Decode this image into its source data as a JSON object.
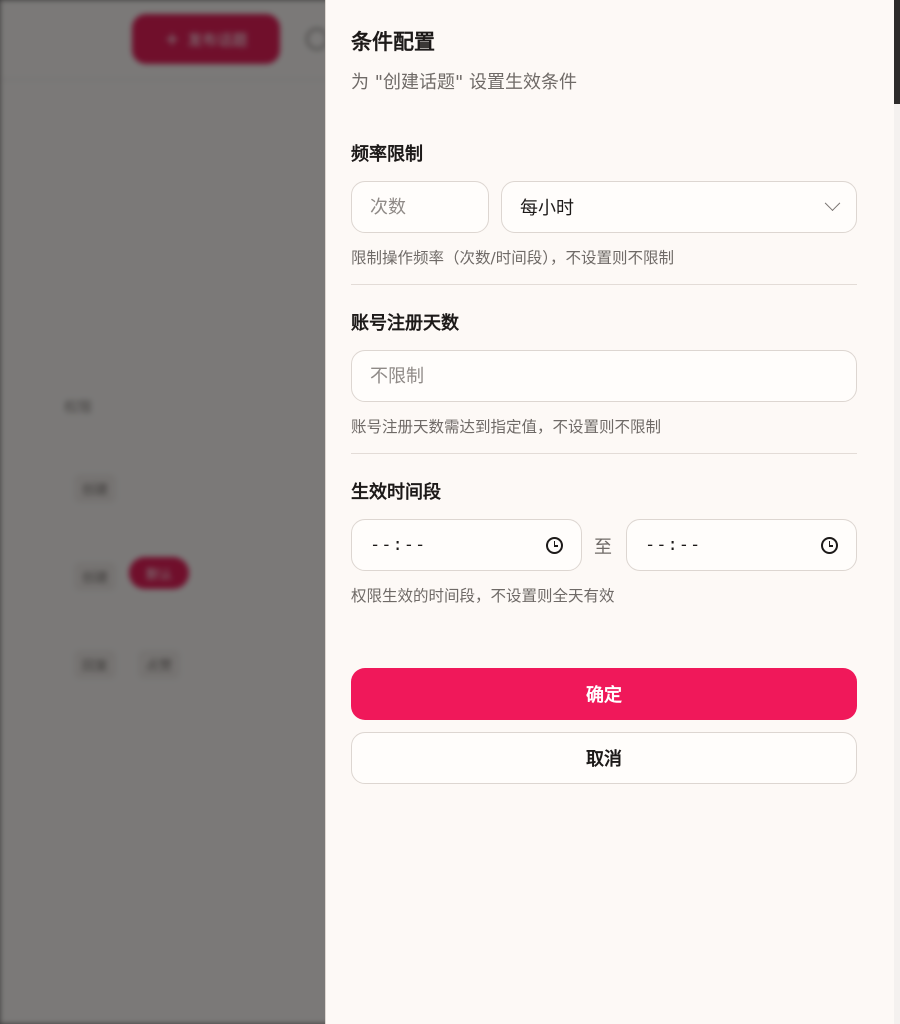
{
  "background": {
    "cta_label": "发布话题",
    "text_1": "权限",
    "chip_1": "创建",
    "chip_2": "创建",
    "pill": "默认",
    "chip_3": "回复",
    "chip_4": "点赞"
  },
  "drawer": {
    "title": "条件配置",
    "subtitle": "为 \"创建话题\" 设置生效条件",
    "frequency": {
      "title": "频率限制",
      "count_placeholder": "次数",
      "period_value": "每小时",
      "hint": "限制操作频率（次数/时间段），不设置则不限制"
    },
    "account_age": {
      "title": "账号注册天数",
      "placeholder": "不限制",
      "hint": "账号注册天数需达到指定值，不设置则不限制"
    },
    "time_range": {
      "title": "生效时间段",
      "start_value": "--:--",
      "separator": "至",
      "end_value": "--:--",
      "hint": "权限生效的时间段，不设置则全天有效"
    },
    "confirm_label": "确定",
    "cancel_label": "取消"
  },
  "colors": {
    "accent": "#f0185a",
    "panel_background": "#fdf9f6",
    "overlay": "rgba(0,0,0,0.5)"
  },
  "icons": [
    "plus-icon",
    "chevron-down-icon",
    "clock-icon"
  ]
}
